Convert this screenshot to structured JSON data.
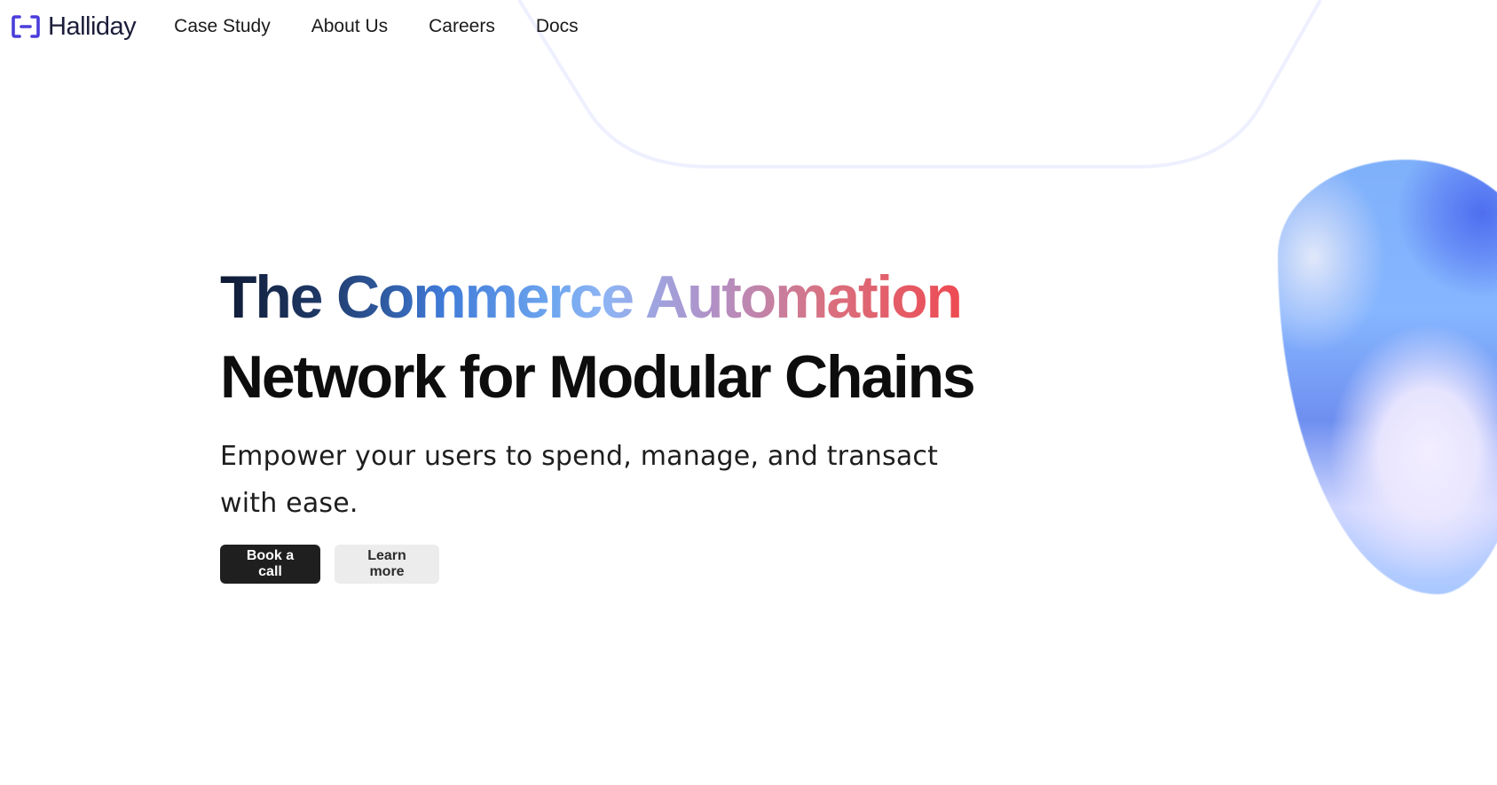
{
  "brand": {
    "name": "Halliday",
    "icon": "halliday-logo-icon",
    "color": "#4b3ddb"
  },
  "nav": {
    "items": [
      {
        "label": "Case Study"
      },
      {
        "label": "About Us"
      },
      {
        "label": "Careers"
      },
      {
        "label": "Docs"
      }
    ]
  },
  "hero": {
    "headline_word_1": "The",
    "headline_highlight": "Commerce Automation",
    "headline_line_2": "Network for Modular Chains",
    "subtitle": "Empower your users to spend, manage, and transact with ease.",
    "primary_button": "Book a call",
    "secondary_button": "Learn more"
  },
  "colors": {
    "gradient_start": "#0f1a34",
    "gradient_mid": "#6ea6ef",
    "gradient_end": "#ee4a52",
    "primary_button_bg": "#1f1f1f",
    "secondary_button_bg": "#ececec",
    "blob_blue": "#7fb0fa"
  }
}
